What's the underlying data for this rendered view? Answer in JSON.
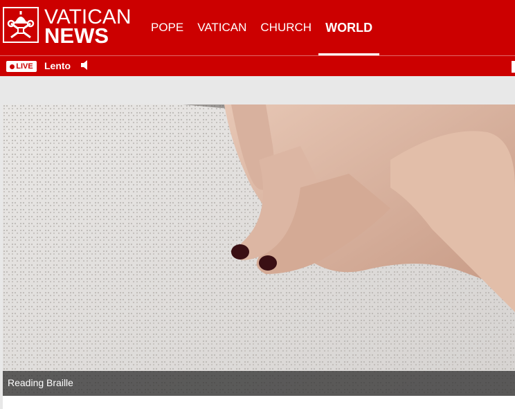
{
  "brand": {
    "line1": "VATICAN",
    "line2": "NEWS"
  },
  "nav": {
    "items": [
      {
        "label": "POPE"
      },
      {
        "label": "VATICAN"
      },
      {
        "label": "CHURCH"
      },
      {
        "label": "WORLD",
        "active": true
      }
    ]
  },
  "live": {
    "badge": "LIVE",
    "title": "Lento"
  },
  "hero": {
    "caption": "Reading Braille"
  },
  "colors": {
    "brand_red": "#cc0000",
    "white": "#ffffff"
  }
}
